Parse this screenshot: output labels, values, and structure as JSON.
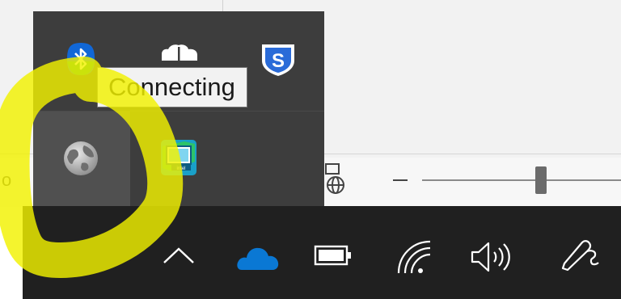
{
  "tooltip": {
    "text": "Connecting"
  },
  "background": {
    "left_letter": "o"
  },
  "flyout": {
    "icons": [
      {
        "name": "bluetooth-icon"
      },
      {
        "name": "cloud-sync-icon"
      },
      {
        "name": "sophos-icon"
      },
      {
        "name": "network-globe-icon"
      },
      {
        "name": "intel-graphics-icon"
      }
    ]
  },
  "taskbar": {
    "icons": [
      "chevron-up-icon",
      "onedrive-icon",
      "battery-icon",
      "wifi-icon",
      "volume-icon",
      "pen-icon"
    ]
  },
  "colors": {
    "taskbar": "#202020",
    "flyout": "#3d3d3d",
    "onedrive": "#0a78d4",
    "highlighter": "#f2f200",
    "bluetooth": "#1167d6",
    "sophos": "#2a6bd8"
  }
}
